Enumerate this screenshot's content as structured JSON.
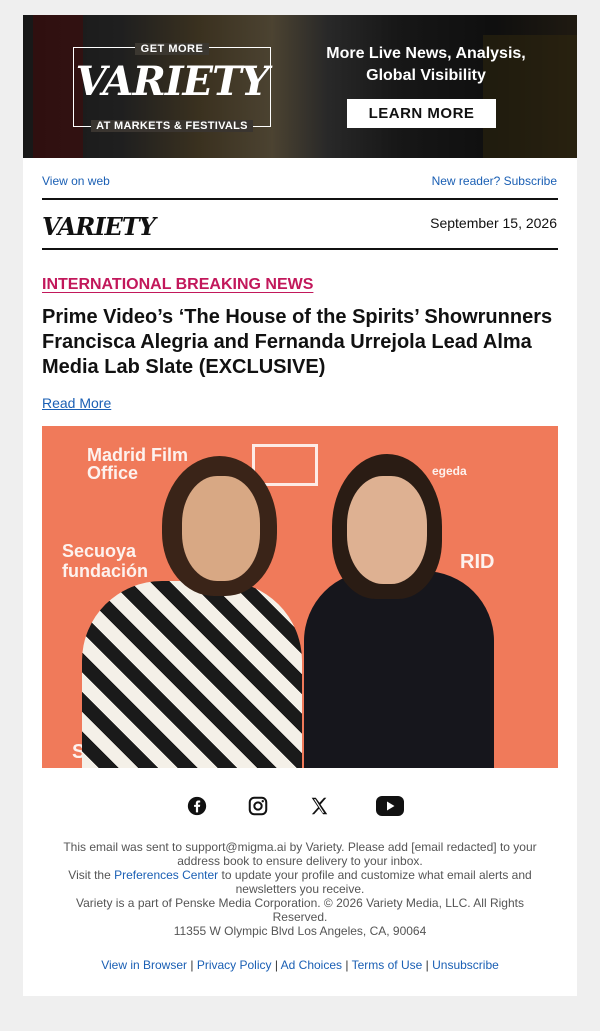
{
  "banner": {
    "badge_top": "GET MORE",
    "badge_logo": "VARIETY",
    "badge_bottom": "AT MARKETS & FESTIVALS",
    "tagline": "More Live News, Analysis, Global Visibility",
    "cta": "LEARN MORE"
  },
  "header": {
    "view_on_web": "View on web",
    "new_reader": "New reader? Subscribe",
    "logo": "VARIETY",
    "date": "September 15, 2026"
  },
  "article": {
    "kicker": "INTERNATIONAL BREAKING NEWS",
    "headline": "Prime Video’s ‘The House of the Spirits’ Showrunners Francisca Alegria and Fernanda Urrejola Lead Alma Media Lab Slate (EXCLUSIVE)",
    "read_more": "Read More"
  },
  "photo_backdrop": {
    "madrid": "Madrid Film Office",
    "secuoya": "Secuoya fundación",
    "egeda": "egeda",
    "rid": "RID",
    "secu": "Secu"
  },
  "social": {
    "icons": [
      "facebook-icon",
      "instagram-icon",
      "x-icon",
      "youtube-icon"
    ]
  },
  "footer": {
    "line1": "This email was sent to support@migma.ai by Variety. Please add [email redacted] to your address book to ensure delivery to your inbox.",
    "visit_pre": "Visit the ",
    "preferences": "Preferences Center",
    "visit_post": " to update your profile and customize what email alerts and newsletters you receive.",
    "line3": "Variety is a part of Penske Media Corporation. © 2026 Variety Media, LLC. All Rights Reserved.",
    "address": "11355 W Olympic Blvd Los Angeles, CA, 90064",
    "links": [
      "View in Browser",
      "Privacy Policy",
      "Ad Choices",
      "Terms of Use",
      "Unsubscribe"
    ],
    "separator": "|"
  },
  "colors": {
    "kicker": "#c2185b",
    "link": "#1a5fb4",
    "photo_bg": "#f07a5a"
  }
}
